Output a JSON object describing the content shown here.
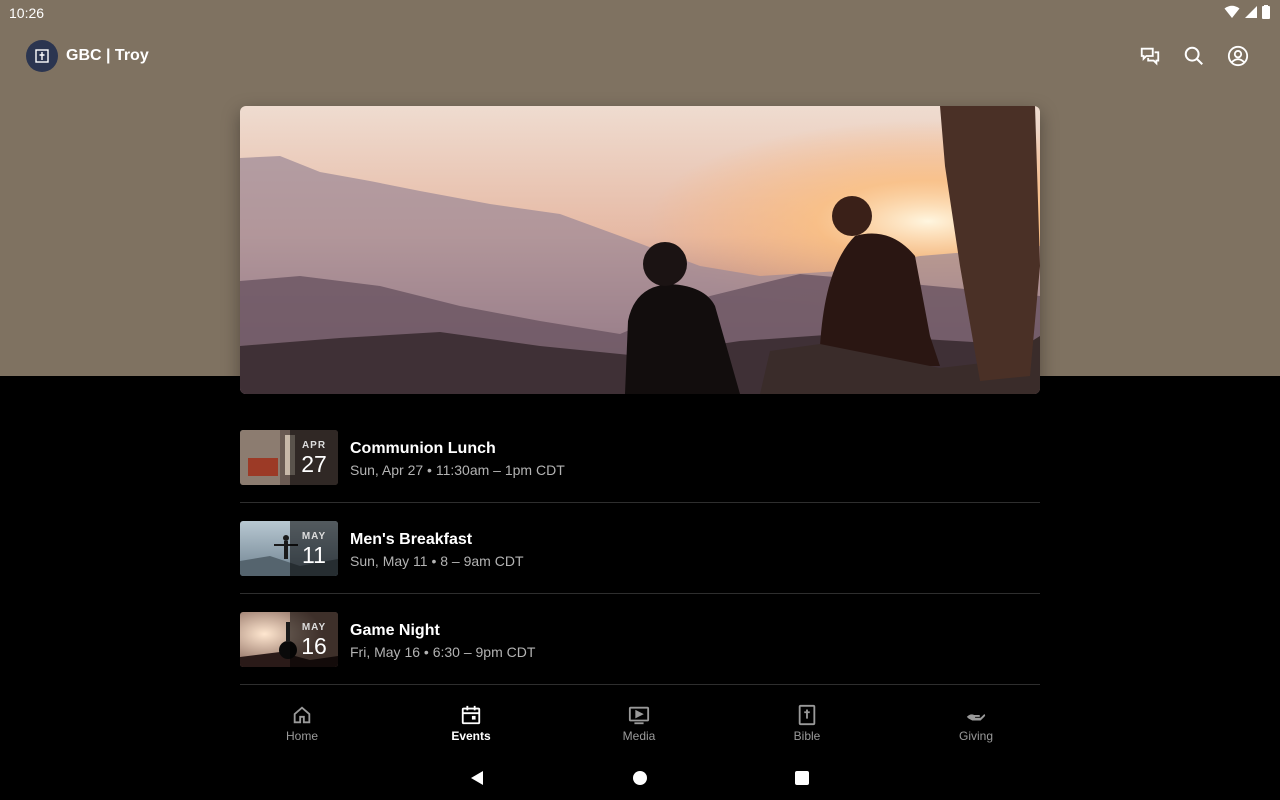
{
  "status": {
    "time": "10:26"
  },
  "app": {
    "title": "GBC | Troy"
  },
  "events": [
    {
      "month": "APR",
      "day": "27",
      "title": "Communion Lunch",
      "subtitle": "Sun, Apr 27 • 11:30am – 1pm CDT"
    },
    {
      "month": "MAY",
      "day": "11",
      "title": "Men's Breakfast",
      "subtitle": "Sun, May 11 • 8 – 9am CDT"
    },
    {
      "month": "MAY",
      "day": "16",
      "title": "Game Night",
      "subtitle": "Fri, May 16 • 6:30 – 9pm CDT"
    }
  ],
  "nav": {
    "home": "Home",
    "events": "Events",
    "media": "Media",
    "bible": "Bible",
    "giving": "Giving",
    "active": "events"
  },
  "colors": {
    "header_bg": "#7f7261",
    "body_bg": "#000000",
    "logo_bg": "#2b3550"
  }
}
